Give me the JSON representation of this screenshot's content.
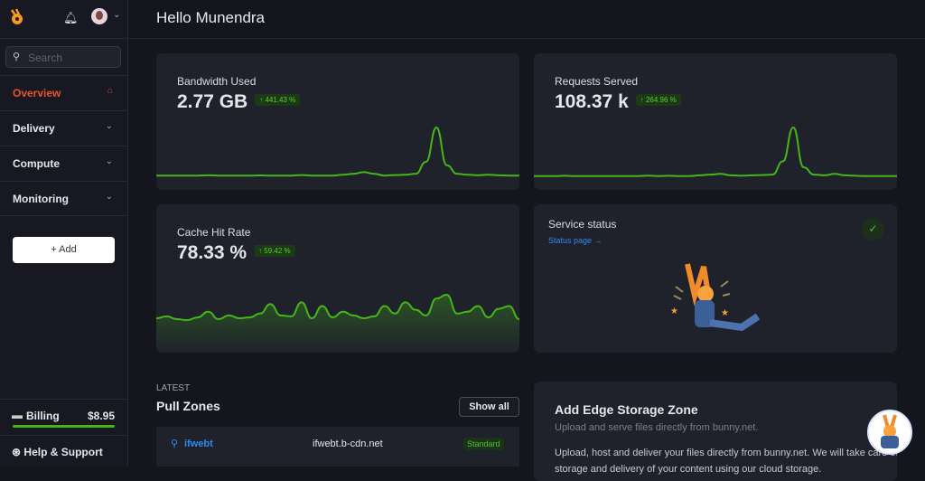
{
  "header": {
    "greeting": "Hello Munendra"
  },
  "sidebar": {
    "search_placeholder": "Search",
    "items": [
      {
        "label": "Overview",
        "icon": "home-icon",
        "active": true
      },
      {
        "label": "Delivery",
        "icon": "chevron-down-icon"
      },
      {
        "label": "Compute",
        "icon": "chevron-down-icon"
      },
      {
        "label": "Monitoring",
        "icon": "chevron-down-icon"
      }
    ],
    "add_label": "+ Add",
    "billing_label": "Billing",
    "billing_amount": "$8.95",
    "help_label": "Help & Support"
  },
  "colors": {
    "accent": "#e8542a",
    "green": "#45b618",
    "link": "#2d8cf0"
  },
  "stats": [
    {
      "title": "Bandwidth Used",
      "value": "2.77 GB",
      "change": "↑ 441.43 %",
      "trend": [
        2,
        2,
        2,
        2,
        2,
        2.2,
        2,
        2,
        2,
        2,
        2.1,
        2,
        2,
        2,
        2.3,
        2,
        2,
        2,
        2.5,
        3,
        4,
        3,
        2,
        2.3,
        2.5,
        3,
        10,
        30,
        8,
        3,
        2.5,
        2.2,
        2.5,
        2.2,
        2,
        2
      ]
    },
    {
      "title": "Requests Served",
      "value": "108.37 k",
      "change": "↑ 264.96 %",
      "trend": [
        2,
        2,
        2,
        2.2,
        2,
        2,
        2,
        2,
        2,
        2,
        2,
        2.3,
        2,
        2.2,
        2,
        2,
        2.5,
        3,
        3.5,
        2.5,
        2.2,
        2.5,
        2.7,
        3,
        12,
        35,
        8,
        3,
        2.5,
        3.5,
        2.5,
        2.2,
        2,
        2,
        2,
        2
      ]
    },
    {
      "title": "Cache Hit Rate",
      "value": "78.33 %",
      "change": "↑ 59.42 %",
      "trend": [
        45,
        47,
        44,
        43,
        46,
        52,
        44,
        48,
        45,
        46,
        50,
        60,
        48,
        47,
        62,
        45,
        58,
        46,
        52,
        48,
        45,
        47,
        58,
        50,
        62,
        54,
        48,
        66,
        70,
        50,
        52,
        58,
        46,
        55,
        58,
        44
      ]
    }
  ],
  "service": {
    "title": "Service status",
    "link": "Status page →"
  },
  "pull_zones": {
    "eyebrow": "LATEST",
    "title": "Pull Zones",
    "show_all": "Show all",
    "rows": [
      {
        "name": "ifwebt",
        "hostname": "ifwebt.b-cdn.net",
        "tier": "Standard"
      }
    ]
  },
  "edge_storage": {
    "title": "Add Edge Storage Zone",
    "subtitle": "Upload and serve files directly from bunny.net.",
    "body": "Upload, host and deliver your files directly from bunny.net. We will take care of storage and delivery of your content using our cloud storage."
  }
}
